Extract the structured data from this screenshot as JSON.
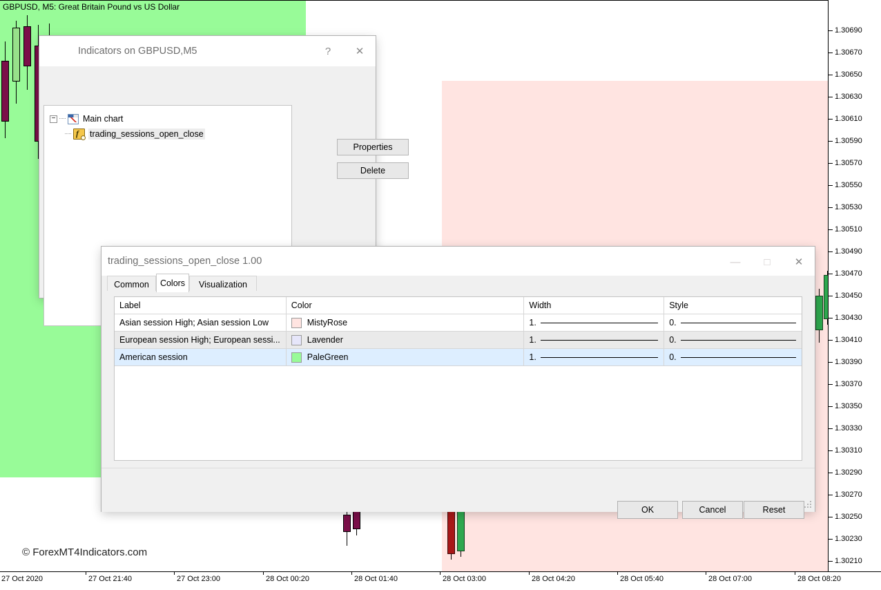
{
  "chart": {
    "symbol_label": "GBPUSD, M5:  Great Britain Pound vs US Dollar",
    "watermark": "© ForexMT4Indicators.com",
    "price_ticks": [
      "1.30690",
      "1.30670",
      "1.30650",
      "1.30630",
      "1.30610",
      "1.30590",
      "1.30570",
      "1.30550",
      "1.30530",
      "1.30510",
      "1.30490",
      "1.30470",
      "1.30450",
      "1.30430",
      "1.30410",
      "1.30390",
      "1.30370",
      "1.30350",
      "1.30330",
      "1.30310",
      "1.30290",
      "1.30270",
      "1.30250",
      "1.30230",
      "1.30210"
    ],
    "time_ticks": [
      "27 Oct 2020",
      "27 Oct 21:40",
      "27 Oct 23:00",
      "28 Oct 00:20",
      "28 Oct 01:40",
      "28 Oct 03:00",
      "28 Oct 04:20",
      "28 Oct 05:40",
      "28 Oct 07:00",
      "28 Oct 08:20"
    ],
    "zones": [
      {
        "name": "american-session",
        "color": "#98fb98"
      },
      {
        "name": "asian-session",
        "color": "#ffe4e1"
      }
    ]
  },
  "indicators_window": {
    "title": "Indicators on GBPUSD,M5",
    "help_label": "?",
    "close_label": "✕",
    "tree": {
      "root_label": "Main chart",
      "child_label": "trading_sessions_open_close",
      "expander_glyph": "−"
    },
    "buttons": {
      "properties": "Properties",
      "delete": "Delete"
    }
  },
  "properties_window": {
    "title": "trading_sessions_open_close 1.00",
    "minimize_label": "—",
    "maximize_label": "□",
    "close_label": "✕",
    "tabs": [
      {
        "id": "common",
        "label": "Common",
        "active": false
      },
      {
        "id": "colors",
        "label": "Colors",
        "active": true
      },
      {
        "id": "visualization",
        "label": "Visualization",
        "active": false
      }
    ],
    "color_table": {
      "headers": [
        "Label",
        "Color",
        "Width",
        "Style"
      ],
      "rows": [
        {
          "label": "Asian session High; Asian session Low",
          "color_name": "MistyRose",
          "color_hex": "#ffe4e1",
          "width": "1.",
          "style": "0."
        },
        {
          "label": "European session High; European sessi...",
          "color_name": "Lavender",
          "color_hex": "#e6e6fa",
          "width": "1.",
          "style": "0."
        },
        {
          "label": "American session",
          "color_name": "PaleGreen",
          "color_hex": "#98fb98",
          "width": "1.",
          "style": "0."
        }
      ]
    },
    "buttons": {
      "ok": "OK",
      "cancel": "Cancel",
      "reset": "Reset"
    }
  }
}
